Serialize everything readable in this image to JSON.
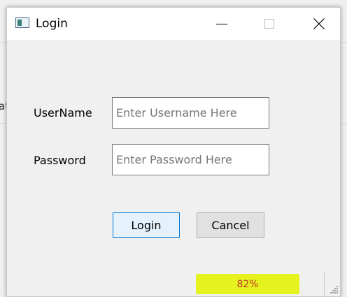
{
  "background": {
    "partial_text": "at"
  },
  "window": {
    "title": "Login",
    "icon": "window-app-icon",
    "controls": {
      "minimize": "minimize-icon",
      "maximize": "maximize-icon",
      "close": "close-icon"
    }
  },
  "form": {
    "username": {
      "label": "UserName",
      "value": "",
      "placeholder": "Enter Username Here"
    },
    "password": {
      "label": "Password",
      "value": "",
      "placeholder": "Enter Password Here"
    },
    "login_label": "Login",
    "cancel_label": "Cancel"
  },
  "progress": {
    "text": "82%",
    "value": 0.82,
    "color": "#e6f21e",
    "text_color": "#c0392b"
  },
  "colors": {
    "login_button_bg": "#e5f1fb",
    "login_button_border": "#0078d7",
    "cancel_button_bg": "#e1e1e1"
  }
}
